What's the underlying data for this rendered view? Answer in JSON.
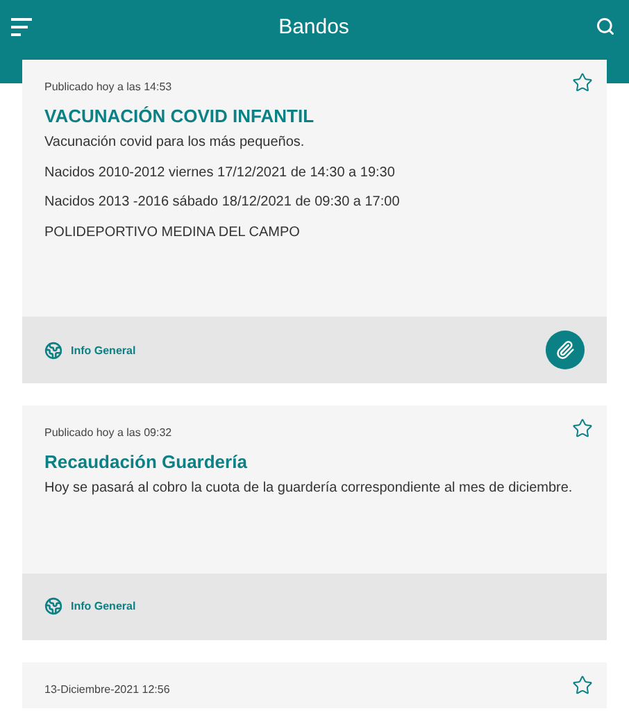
{
  "app_bar": {
    "title": "Bandos"
  },
  "cards": [
    {
      "date": "Publicado hoy a las 14:53",
      "favorite": false,
      "title": "VACUNACIÓN COVID INFANTIL",
      "paragraphs": [
        "Vacunación covid para los más pequeños.",
        "Nacidos 2010-2012 viernes 17/12/2021 de 14:30 a 19:30",
        "Nacidos 2013 -2016 sábado 18/12/2021 de 09:30 a 17:00",
        "POLIDEPORTIVO MEDINA DEL CAMPO"
      ],
      "category": "Info General",
      "attachment": true
    },
    {
      "date": "Publicado hoy a las 09:32",
      "favorite": false,
      "title": "Recaudación Guardería",
      "paragraphs": [
        "Hoy se pasará al cobro la cuota de la guardería correspondiente al mes de diciembre."
      ],
      "category": "Info General",
      "attachment": false
    },
    {
      "date": "13-Diciembre-2021 12:56",
      "favorite": false
    }
  ]
}
